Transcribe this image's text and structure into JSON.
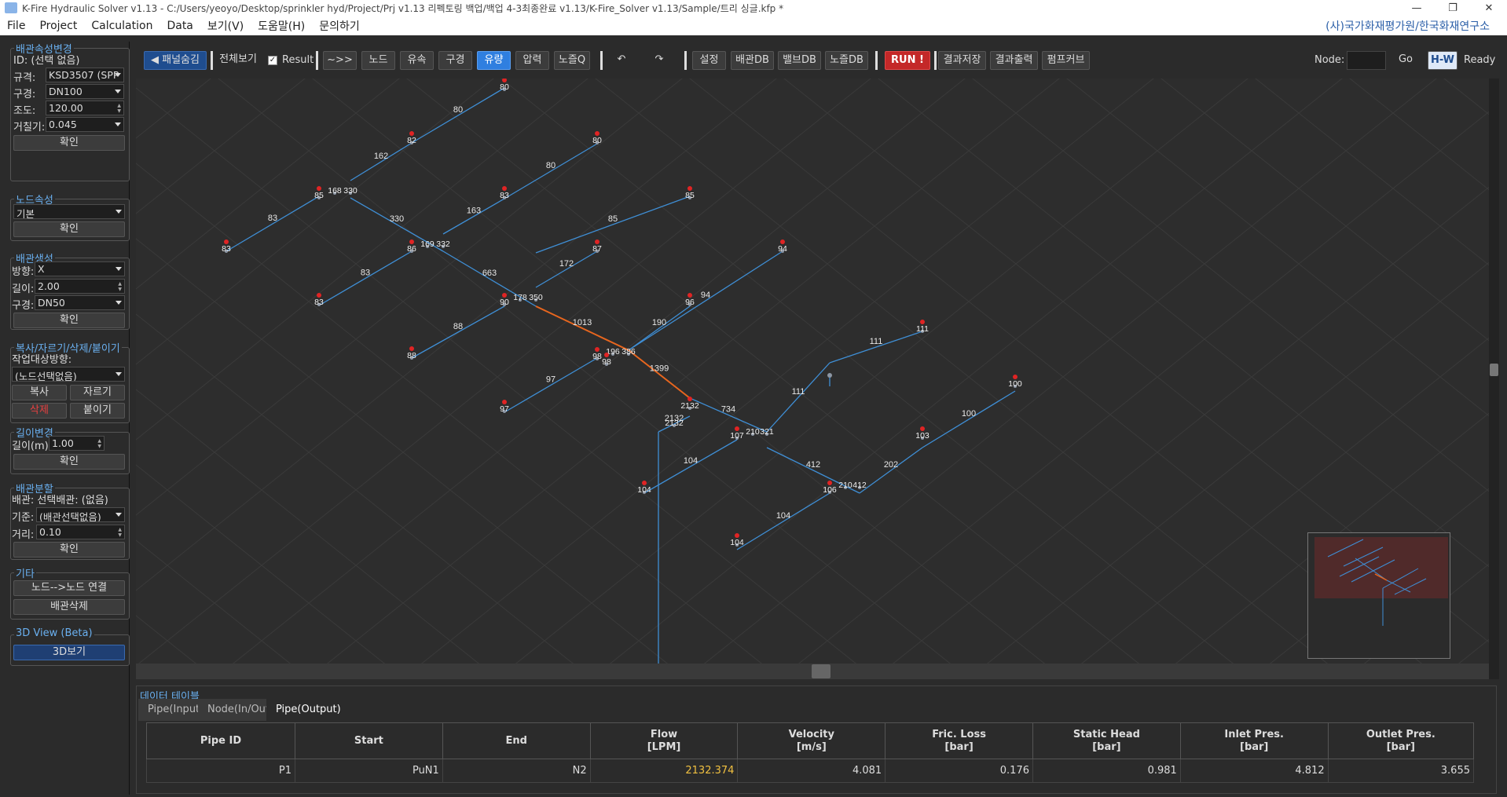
{
  "titlebar": {
    "title": "K-Fire Hydraulic Solver v1.13 - C:/Users/yeoyo/Desktop/sprinkler hyd/Project/Prj v1.13 리펙토링 백업/백업 4-3최종완료 v1.13/K-Fire_Solver v1.13/Sample/트리 싱글.kfp *"
  },
  "menu": {
    "items": [
      "File",
      "Project",
      "Calculation",
      "Data",
      "보기(V)",
      "도움말(H)",
      "문의하기"
    ],
    "brand": "(사)국가화재평가원/한국화재연구소"
  },
  "sidebar": {
    "pipe_props": {
      "title": "배관속성변경",
      "id_label": "ID: (선택 없음)",
      "std_label": "규격:",
      "std_value": "KSD3507 (SPP",
      "size_label": "구경:",
      "size_value": "DN100",
      "c_label": "조도:",
      "c_value": "120.00",
      "rough_label": "거칠기:",
      "rough_value": "0.045",
      "confirm": "확인"
    },
    "node_props": {
      "title": "노드속성",
      "value": "기본",
      "confirm": "확인"
    },
    "pipe_create": {
      "title": "배관생성",
      "dir_label": "방향:",
      "dir_value": "X",
      "len_label": "길이:",
      "len_value": "2.00",
      "size_label": "구경:",
      "size_value": "DN50",
      "confirm": "확인"
    },
    "copy": {
      "title": "복사/자르기/삭제/붙이기",
      "target_label": "작업대상방향:",
      "target_value": "(노드선택없음)",
      "copy": "복사",
      "cut": "자르기",
      "delete": "삭제",
      "paste": "붙이기"
    },
    "length": {
      "title": "길이변경",
      "len_label": "길이(m):",
      "len_value": "1.00",
      "confirm": "확인"
    },
    "split": {
      "title": "배관분할",
      "pipe_label": "배관: 선택배관: (없음)",
      "base_label": "기준:",
      "base_value": "(배관선택없음)",
      "dist_label": "거리:",
      "dist_value": "0.10",
      "confirm": "확인"
    },
    "etc": {
      "title": "기타",
      "connect": "노드-->노드 연결",
      "delete_pipe": "배관삭제"
    },
    "view3d": {
      "title": "3D View (Beta)",
      "button": "3D보기"
    }
  },
  "toolbar": {
    "hide_panel": "◀ 패널숨김",
    "fit": "전체보기",
    "result": "Result",
    "arrow": "~>>",
    "node": "노드",
    "velocity": "유속",
    "size": "구경",
    "flow": "유량",
    "pressure": "압력",
    "nozzleq": "노즐Q",
    "undo": "↶",
    "redo": "↷",
    "settings": "설정",
    "pipedb": "배관DB",
    "valvedb": "밸브DB",
    "nozzledb": "노즐DB",
    "run": "RUN !",
    "save": "결과저장",
    "print": "결과출력",
    "pumpcurve": "펌프커브",
    "node_label": "Node:",
    "go": "Go",
    "hw": "H-W",
    "status": "Ready"
  },
  "colors": {
    "pipe": "#3f8fd6",
    "critical": "#e8661e",
    "node": "#8c96a4",
    "sprinkler": "#e02424",
    "active": "#2f7fe0",
    "run": "#c42828"
  },
  "network": {
    "pipe_labels": [
      "80",
      "162",
      "80",
      "83",
      "330",
      "163",
      "85",
      "663",
      "172",
      "83",
      "94",
      "1013",
      "190",
      "88",
      "1399",
      "111",
      "97",
      "111",
      "734",
      "2132",
      "100",
      "104",
      "412",
      "202",
      "104"
    ],
    "node_labels": [
      "80",
      "82",
      "80",
      "85",
      "168",
      "330",
      "83",
      "85",
      "83",
      "86",
      "169",
      "332",
      "87",
      "94",
      "83",
      "90",
      "178",
      "350",
      "96",
      "98",
      "196",
      "386",
      "111",
      "88",
      "98",
      "2132",
      "97",
      "100",
      "2132",
      "107",
      "210",
      "321",
      "103",
      "104",
      "106",
      "210",
      "412",
      "104"
    ]
  },
  "datatable": {
    "title": "데이터 테이블",
    "tabs": [
      "Pipe(Input)",
      "Node(In/Out)",
      "Pipe(Output)"
    ],
    "headers": [
      "Pipe ID",
      "Start",
      "End",
      "Flow\n[LPM]",
      "Velocity\n[m/s]",
      "Fric. Loss\n[bar]",
      "Static Head\n[bar]",
      "Inlet Pres.\n[bar]",
      "Outlet Pres.\n[bar]"
    ],
    "rows": [
      [
        "P1",
        "PuN1",
        "N2",
        "2132.374",
        "4.081",
        "0.176",
        "0.981",
        "4.812",
        "3.655"
      ]
    ]
  }
}
